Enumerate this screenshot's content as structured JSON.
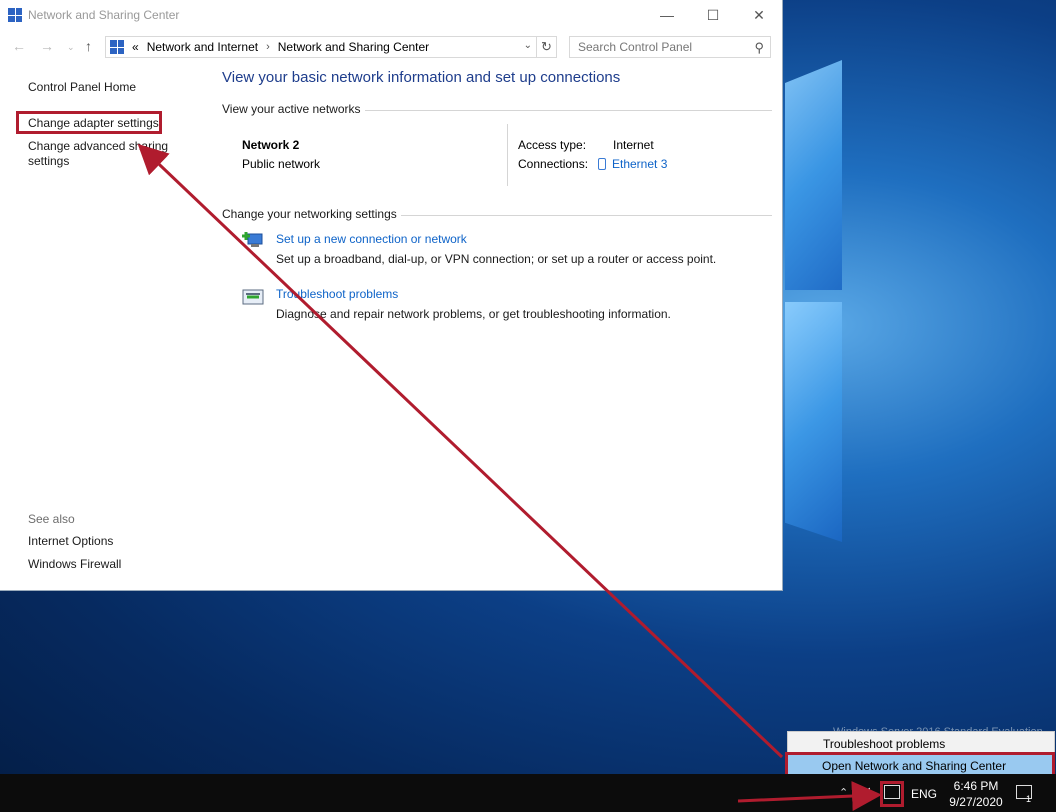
{
  "window": {
    "title": "Network and Sharing Center",
    "controls": {
      "minimize": "—",
      "maximize": "☐",
      "close": "✕"
    }
  },
  "address": {
    "prefix": "«",
    "crumbs": [
      "Network and Internet",
      "Network and Sharing Center"
    ],
    "separator": "›",
    "search_placeholder": "Search Control Panel"
  },
  "sidebar": {
    "home": "Control Panel Home",
    "adapter": "Change adapter settings",
    "advanced_line1": "Change advanced sharing",
    "advanced_line2": "settings",
    "see_also": "See also",
    "internet_options": "Internet Options",
    "firewall": "Windows Firewall"
  },
  "main": {
    "heading": "View your basic network information and set up connections",
    "active_networks_label": "View your active networks",
    "network_name": "Network  2",
    "network_type": "Public network",
    "access_type_label": "Access type:",
    "access_type_value": "Internet",
    "connections_label": "Connections:",
    "connections_value": "Ethernet 3",
    "change_settings_label": "Change your networking settings",
    "tasks": [
      {
        "link": "Set up a new connection or network",
        "desc": "Set up a broadband, dial-up, or VPN connection; or set up a router or access point."
      },
      {
        "link": "Troubleshoot problems",
        "desc": "Diagnose and repair network problems, or get troubleshooting information."
      }
    ]
  },
  "context_menu": {
    "items": [
      "Troubleshoot problems",
      "Open Network and Sharing Center"
    ]
  },
  "taskbar": {
    "language": "ENG",
    "time": "6:46 PM",
    "date": "9/27/2020",
    "notification_count": "1"
  },
  "colors": {
    "annotation": "#b01c2e",
    "link": "#0e63c8",
    "heading": "#1e3d8c"
  }
}
